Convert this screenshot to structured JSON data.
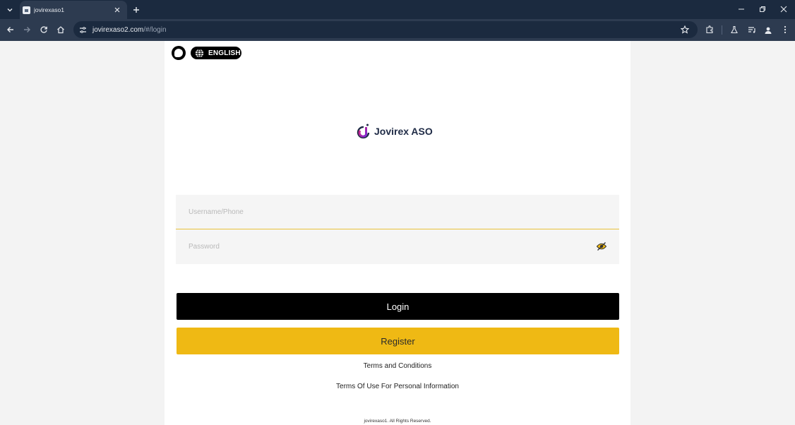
{
  "browser": {
    "tab_title": "jovirexaso1",
    "url_domain": "jovirexaso2.com",
    "url_path": "/#/login",
    "icons": [
      "tab-list-icon",
      "page-favicon",
      "close-icon",
      "plus-icon",
      "minimize-icon",
      "restore-icon",
      "close-window-icon",
      "back-arrow-icon",
      "forward-arrow-icon",
      "reload-icon",
      "home-icon",
      "site-info-icon",
      "bookmark-star-icon",
      "extensions-icon",
      "labs-flask-icon",
      "media-queue-icon",
      "profile-icon",
      "more-menu-icon"
    ]
  },
  "header": {
    "chat_icon": "chat-bubble-icon",
    "language_icon": "globe-icon",
    "language_label": "ENGLISH"
  },
  "brand": {
    "name": "Jovirex ASO",
    "logo_colors": [
      "#e0227a",
      "#7d2ad6",
      "#1f2b46"
    ]
  },
  "form": {
    "username_placeholder": "Username/Phone",
    "password_placeholder": "Password",
    "password_toggle_icon": "eye-slash-icon"
  },
  "buttons": {
    "login_label": "Login",
    "register_label": "Register"
  },
  "links": {
    "terms": "Terms and Conditions",
    "privacy": "Terms Of Use For Personal Information"
  },
  "footer": {
    "copyright": "jovirexaso1. All Rights Reserved."
  },
  "colors": {
    "accent_yellow": "#efb914",
    "login_black": "#000000",
    "chrome_dark": "#1b2a3f"
  }
}
